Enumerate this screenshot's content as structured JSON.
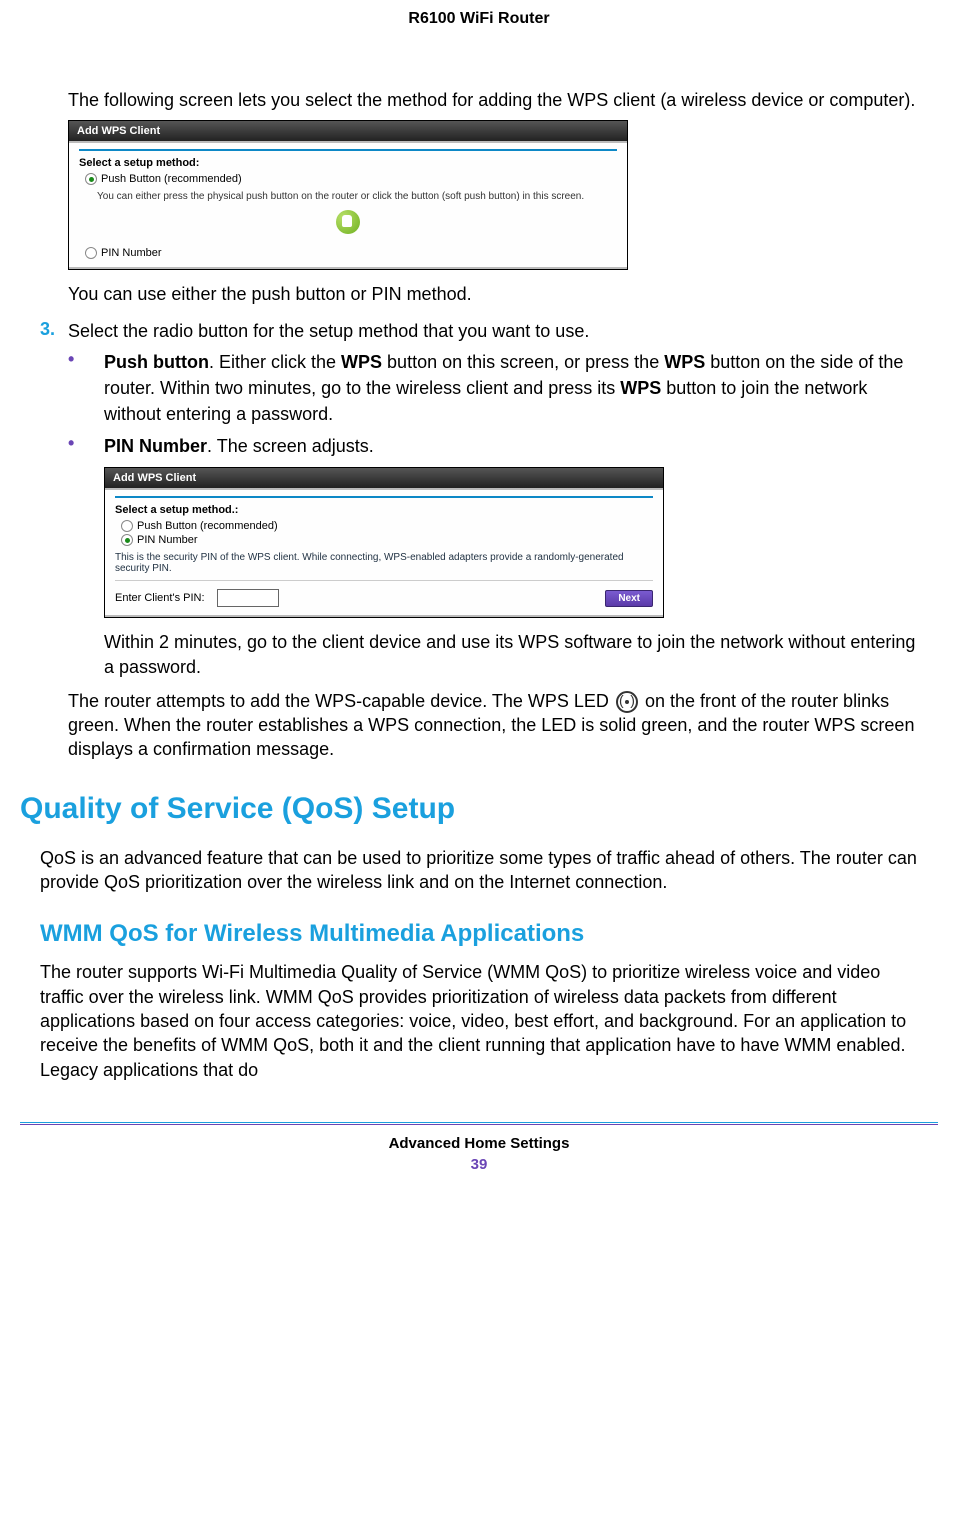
{
  "header": {
    "title": "R6100 WiFi Router"
  },
  "intro": {
    "p1": "The following screen lets you select the method for adding the WPS client (a wireless device or computer).",
    "p2": "You can use either the push button or PIN method."
  },
  "shot1": {
    "title": "Add WPS Client",
    "select_label": "Select a setup method:",
    "opt_push": "Push Button (recommended)",
    "hint": "You can either press the physical push button on the router or click the button (soft push button) in this screen.",
    "opt_pin": "PIN Number"
  },
  "step3": {
    "num": "3.",
    "text": "Select the radio button for the setup method that you want to use."
  },
  "bullets": {
    "b1": {
      "lead_bold": "Push button",
      "tail": ". Either click the ",
      "wps1": "WPS",
      "mid": " button on this screen, or press the ",
      "wps2": "WPS",
      "mid2": " button on the side of the router. Within two minutes, go to the wireless client and press its ",
      "wps3": "WPS",
      "end": " button to join the network without entering a password."
    },
    "b2": {
      "lead_bold": "PIN Number",
      "tail": ". The screen adjusts."
    }
  },
  "shot2": {
    "title": "Add WPS Client",
    "select_label": "Select a setup method.:",
    "opt_push": "Push Button (recommended)",
    "opt_pin": "PIN Number",
    "hint": "This is the security PIN of the WPS client. While connecting, WPS-enabled adapters provide a randomly-generated security PIN.",
    "enter_pin": "Enter Client's PIN:",
    "next": "Next"
  },
  "after_shot2": "Within 2 minutes, go to the client device and use its WPS software to join the network without entering a password.",
  "closing": {
    "pre": "The router attempts to add the WPS-capable device. The WPS LED ",
    "post": " on the front of the router blinks green. When the router establishes a WPS connection, the LED is solid green, and the router WPS screen displays a confirmation message."
  },
  "h1": "Quality of Service (QoS) Setup",
  "qos_p": "QoS is an advanced feature that can be used to prioritize some types of traffic ahead of others. The router can provide QoS prioritization over the wireless link and on the Internet connection.",
  "h2": "WMM QoS for Wireless Multimedia Applications",
  "wmm_p": "The router supports Wi-Fi Multimedia Quality of Service (WMM QoS) to prioritize wireless voice and video traffic over the wireless link. WMM QoS provides prioritization of wireless data packets from different applications based on four access categories: voice, video, best effort, and background. For an application to receive the benefits of WMM QoS, both it and the client running that application have to have WMM enabled. Legacy applications that do",
  "footer": {
    "section": "Advanced Home Settings",
    "page": "39"
  }
}
